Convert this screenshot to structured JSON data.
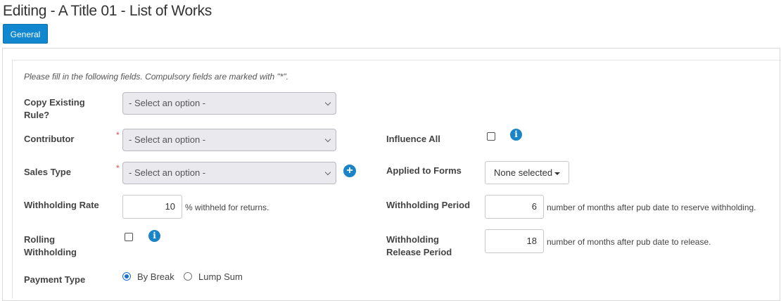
{
  "page": {
    "title": "Editing - A Title 01 - List of Works",
    "tab_general": "General",
    "instructions": "Please fill in the following fields. Compulsory fields are marked with \"*\".",
    "required_marker": "*"
  },
  "form": {
    "copy_existing_rule": {
      "label": "Copy Existing Rule?",
      "value": "- Select an option -"
    },
    "contributor": {
      "label": "Contributor",
      "value": "- Select an option -"
    },
    "sales_type": {
      "label": "Sales Type",
      "value": "- Select an option -"
    },
    "withholding_rate": {
      "label": "Withholding Rate",
      "value": "10",
      "hint": "% withheld for returns."
    },
    "rolling_withholding": {
      "label": "Rolling Withholding",
      "checked": false
    },
    "payment_type": {
      "label": "Payment Type",
      "options": [
        "By Break",
        "Lump Sum"
      ],
      "selected": "By Break"
    },
    "influence_all": {
      "label": "Influence All",
      "checked": false
    },
    "applied_to_forms": {
      "label": "Applied to Forms",
      "value": "None selected"
    },
    "withholding_period": {
      "label": "Withholding Period",
      "value": "6",
      "hint": "number of months after pub date to reserve withholding."
    },
    "withholding_release_period": {
      "label": "Withholding Release Period",
      "value": "18",
      "hint": "number of months after pub date to release."
    }
  },
  "colors": {
    "accent": "#1187d0",
    "required": "#d9534f",
    "select_bg": "#e9e9ee"
  },
  "icons": {
    "info": "info-icon",
    "add": "plus-circle-icon",
    "chevron": "chevron-down-icon",
    "caret": "caret-down-icon"
  }
}
